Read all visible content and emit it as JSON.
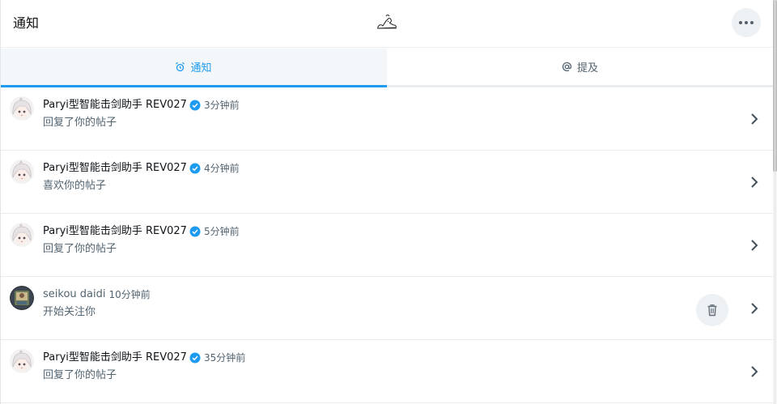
{
  "header": {
    "title": "通知",
    "logo_icon": "anime-chibi-logo-icon",
    "more_icon": "more-horizontal-icon"
  },
  "tabs": [
    {
      "label": "通知",
      "icon": "alarm-bell-icon",
      "active": true
    },
    {
      "label": "提及",
      "icon": "at-sign-icon",
      "active": false
    }
  ],
  "colors": {
    "accent": "#1d9bf0",
    "text_primary": "#0f1419",
    "text_secondary": "#536471",
    "divider": "#e8ecef",
    "button_bg": "#eef1f4"
  },
  "notifications": [
    {
      "user": "Paryi型智能击剑助手 REV027",
      "verified": true,
      "time": "3分钟前",
      "action": "回复了你的帖子",
      "avatar": "white-hair-anime-avatar"
    },
    {
      "user": "Paryi型智能击剑助手 REV027",
      "verified": true,
      "time": "4分钟前",
      "action": "喜欢你的帖子",
      "avatar": "white-hair-anime-avatar"
    },
    {
      "user": "Paryi型智能击剑助手 REV027",
      "verified": true,
      "time": "5分钟前",
      "action": "回复了你的帖子",
      "avatar": "white-hair-anime-avatar"
    },
    {
      "user": "seikou daidi",
      "verified": false,
      "time": "10分钟前",
      "action": "开始关注你",
      "avatar": "dark-portrait-avatar",
      "show_delete": true
    },
    {
      "user": "Paryi型智能击剑助手 REV027",
      "verified": true,
      "time": "35分钟前",
      "action": "回复了你的帖子",
      "avatar": "white-hair-anime-avatar"
    }
  ]
}
